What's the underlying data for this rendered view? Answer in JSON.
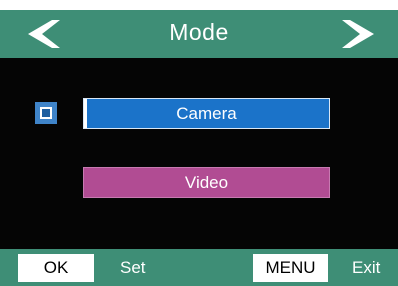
{
  "header": {
    "title": "Mode",
    "prev_icon": "chevron-left-icon",
    "next_icon": "chevron-right-icon"
  },
  "options": [
    {
      "label": "Camera",
      "selected": true,
      "color": "#1b73c9"
    },
    {
      "label": "Video",
      "selected": false,
      "color": "#b14c93"
    }
  ],
  "footer": {
    "ok_key": "OK",
    "ok_action": "Set",
    "menu_key": "MENU",
    "menu_action": "Exit"
  },
  "colors": {
    "bar": "#3e8e76",
    "background": "#050505",
    "checkbox": "#3f84c9"
  }
}
